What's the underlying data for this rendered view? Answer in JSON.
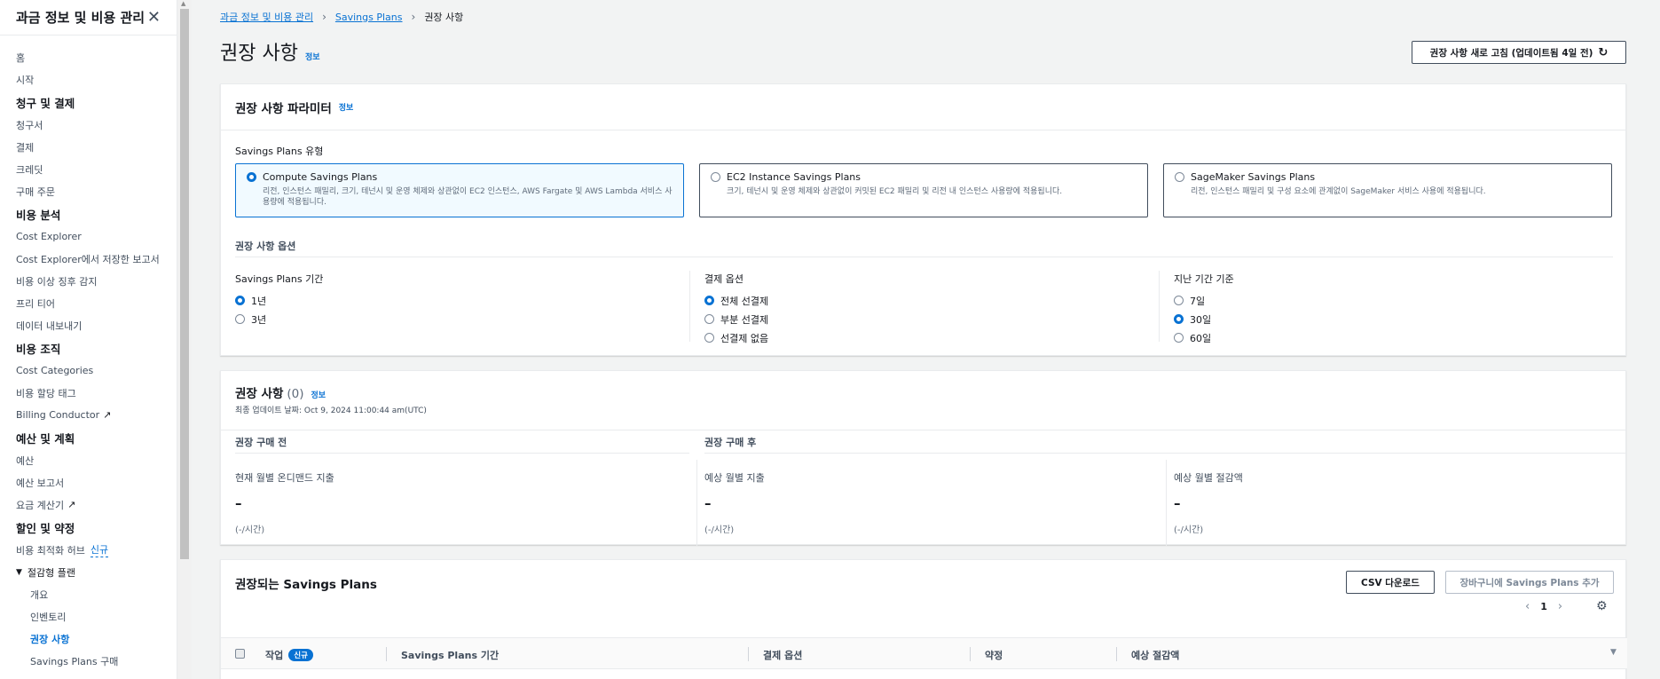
{
  "sidebar": {
    "title": "과금 정보 및 비용 관리",
    "items": [
      {
        "label": "홈",
        "type": "item"
      },
      {
        "label": "시작",
        "type": "item"
      },
      {
        "label": "청구 및 결제",
        "type": "section"
      },
      {
        "label": "청구서",
        "type": "item"
      },
      {
        "label": "결제",
        "type": "item"
      },
      {
        "label": "크레딧",
        "type": "item"
      },
      {
        "label": "구매 주문",
        "type": "item"
      },
      {
        "label": "비용 분석",
        "type": "section"
      },
      {
        "label": "Cost Explorer",
        "type": "item"
      },
      {
        "label": "Cost Explorer에서 저장한 보고서",
        "type": "item"
      },
      {
        "label": "비용 이상 징후 감지",
        "type": "item"
      },
      {
        "label": "프리 티어",
        "type": "item"
      },
      {
        "label": "데이터 내보내기",
        "type": "item"
      },
      {
        "label": "비용 조직",
        "type": "section"
      },
      {
        "label": "Cost Categories",
        "type": "item"
      },
      {
        "label": "비용 할당 태그",
        "type": "item"
      },
      {
        "label": "Billing Conductor",
        "type": "item",
        "external": true
      },
      {
        "label": "예산 및 계획",
        "type": "section"
      },
      {
        "label": "예산",
        "type": "item"
      },
      {
        "label": "예산 보고서",
        "type": "item"
      },
      {
        "label": "요금 계산기",
        "type": "item",
        "external": true
      },
      {
        "label": "할인 및 약정",
        "type": "section"
      },
      {
        "label": "비용 최적화 허브",
        "type": "item",
        "new": "신규"
      },
      {
        "label": "절감형 플랜",
        "type": "group"
      },
      {
        "label": "개요",
        "type": "sub"
      },
      {
        "label": "인벤토리",
        "type": "sub"
      },
      {
        "label": "권장 사항",
        "type": "sub",
        "active": true
      },
      {
        "label": "Savings Plans 구매",
        "type": "sub"
      }
    ]
  },
  "breadcrumb": {
    "b1": "과금 정보 및 비용 관리",
    "b2": "Savings Plans",
    "current": "권장 사항"
  },
  "page": {
    "title": "권장 사항",
    "info": "정보",
    "refresh_label": "권장 사항 새로 고침 (업데이트됨 4일 전)"
  },
  "params": {
    "title": "권장 사항 파라미터",
    "info": "정보",
    "type_label": "Savings Plans 유형",
    "cards": [
      {
        "title": "Compute Savings Plans",
        "desc": "리전, 인스턴스 패밀리, 크기, 테넌시 및 운영 체제와 상관없이 EC2 인스턴스, AWS Fargate 및 AWS Lambda 서비스 사용량에 적용됩니다.",
        "selected": true
      },
      {
        "title": "EC2 Instance Savings Plans",
        "desc": "크기, 테넌시 및 운영 체제와 상관없이 커밋된 EC2 패밀리 및 리전 내 인스턴스 사용량에 적용됩니다.",
        "selected": false
      },
      {
        "title": "SageMaker Savings Plans",
        "desc": "리전, 인스턴스 패밀리 및 구성 요소에 관계없이 SageMaker 서비스 사용에 적용됩니다.",
        "selected": false
      }
    ],
    "options_title": "권장 사항 옵션",
    "term": {
      "label": "Savings Plans 기간",
      "options": [
        "1년",
        "3년"
      ],
      "selected": 0
    },
    "payment": {
      "label": "결제 옵션",
      "options": [
        "전체 선결제",
        "부분 선결제",
        "선결제 없음"
      ],
      "selected": 0
    },
    "lookback": {
      "label": "지난 기간 기준",
      "options": [
        "7일",
        "30일",
        "60일"
      ],
      "selected": 1
    }
  },
  "recs": {
    "title": "권장 사항",
    "count": "(0)",
    "info": "정보",
    "updated": "최종 업데이트 날짜: Oct 9, 2024 11:00:44 am(UTC)",
    "before_label": "권장 구매 전",
    "after_label": "권장 구매 후",
    "metrics": [
      {
        "label": "현재 월별 온디맨드 지출",
        "value": "–",
        "unit": "(-/시간)"
      },
      {
        "label": "예상 월별 지출",
        "value": "–",
        "unit": "(-/시간)"
      },
      {
        "label": "예상 월별 절감액",
        "value": "–",
        "unit": "(-/시간)"
      }
    ]
  },
  "table": {
    "title": "권장되는 Savings Plans",
    "csv_label": "CSV 다운로드",
    "cart_label": "장바구니에 Savings Plans 추가",
    "page": "1",
    "columns": {
      "action": "작업",
      "action_badge": "신규",
      "term": "Savings Plans 기간",
      "payment": "결제 옵션",
      "commitment": "약정",
      "savings": "예상 절감액"
    }
  },
  "colors": {
    "accent": "#0972d3",
    "text": "#16191f",
    "background": "#f2f3f3"
  }
}
